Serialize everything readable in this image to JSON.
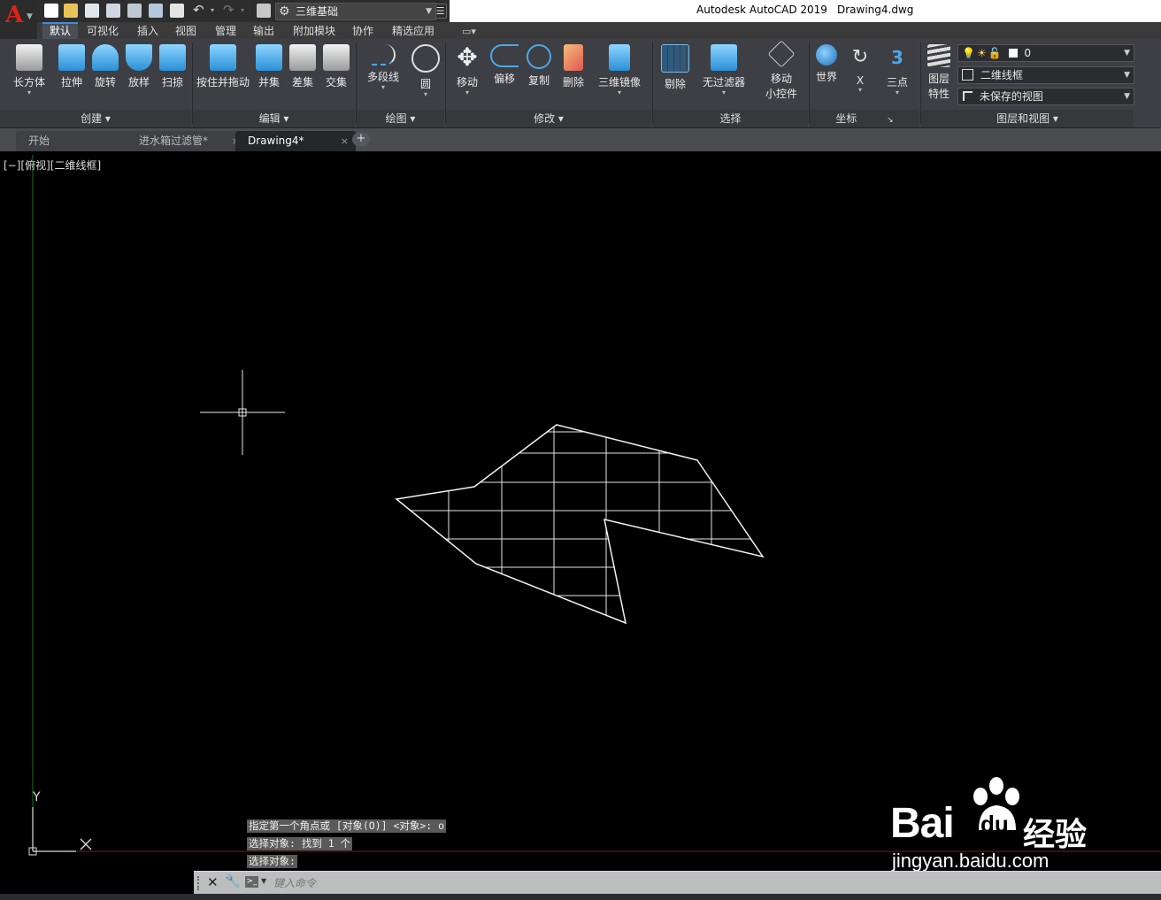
{
  "title_bar": {
    "app_title": "Autodesk AutoCAD 2019",
    "document": "Drawing4.dwg",
    "app_button_letter": "A",
    "workspace": "三维基础",
    "quick_access_icons": [
      "new-icon",
      "open-icon",
      "save-icon",
      "save-as-icon",
      "open-web-icon",
      "save-web-icon",
      "plot-icon",
      "undo-icon",
      "redo-icon",
      "share-icon"
    ]
  },
  "ribbon_tabs": [
    "默认",
    "可视化",
    "插入",
    "视图",
    "管理",
    "输出",
    "附加模块",
    "协作",
    "精选应用"
  ],
  "ribbon": {
    "create": {
      "title": "创建",
      "buttons": [
        "长方体",
        "拉伸",
        "旋转",
        "放样",
        "扫掠"
      ]
    },
    "edit": {
      "title": "编辑",
      "buttons": [
        "按住并拖动",
        "并集",
        "差集",
        "交集"
      ]
    },
    "draw": {
      "title": "绘图",
      "buttons": [
        "多段线",
        "圆"
      ]
    },
    "modify": {
      "title": "修改",
      "buttons": [
        "移动",
        "偏移",
        "复制",
        "删除",
        "三维镜像"
      ]
    },
    "select": {
      "title": "选择",
      "buttons": [
        "剔除",
        "无过滤器",
        "移动",
        "小控件"
      ]
    },
    "coords": {
      "title": "坐标",
      "buttons": [
        "世界",
        "X",
        "三点"
      ]
    },
    "layers": {
      "title": "图层和视图",
      "props_button": [
        "图层",
        "特性"
      ],
      "layer_value": "0",
      "visual_style": "二维线框",
      "view": "未保存的视图"
    }
  },
  "doc_tabs": [
    {
      "label": "开始",
      "close": ""
    },
    {
      "label": "进水箱过滤管*",
      "close": "×"
    },
    {
      "label": "Drawing4*",
      "close": "×"
    }
  ],
  "new_tab": "+",
  "viewport_label": "[−][俯视][二维线框]",
  "ucs": {
    "y": "Y",
    "x": "X"
  },
  "command_history": [
    "指定第一个角点或 [对象(O)] <对象>: o",
    "选择对象: 找到 1 个",
    "选择对象:"
  ],
  "command_input": {
    "placeholder": "键入命令"
  },
  "watermark": {
    "brand": "Bai",
    "paw": "du",
    "product": "经验",
    "url": "jingyan.baidu.com"
  },
  "colors": {
    "accent": "#3c8fd8",
    "canvas": "#000000",
    "ribbon": "#3d3f44",
    "app_icon": "#e0201b"
  }
}
